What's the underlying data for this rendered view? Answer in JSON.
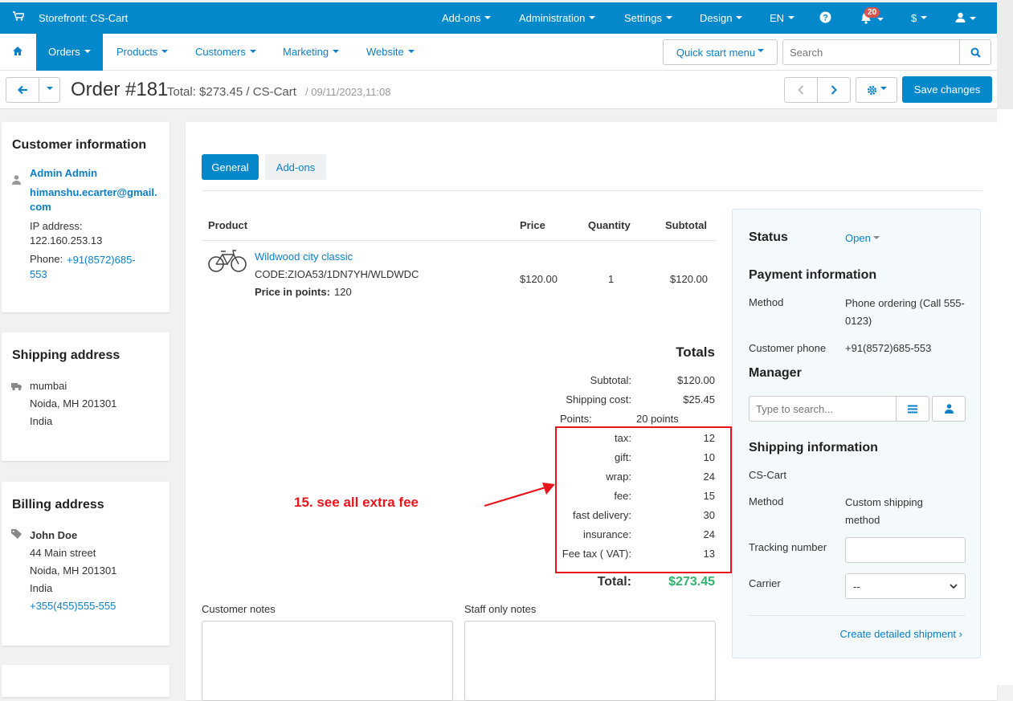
{
  "topbar": {
    "store": "Storefront: CS-Cart",
    "menu": [
      "Add-ons",
      "Administration",
      "Settings",
      "Design",
      "EN"
    ],
    "notif_count": "20",
    "currency": "$"
  },
  "nav": {
    "items": [
      "Orders",
      "Products",
      "Customers",
      "Marketing",
      "Website"
    ],
    "quick_start": "Quick start menu",
    "search_placeholder": "Search"
  },
  "header": {
    "title": "Order #181",
    "total": "Total: $273.45 / CS-Cart",
    "date": "/ 09/11/2023,11:08",
    "save": "Save changes"
  },
  "customer": {
    "heading": "Customer information",
    "name": "Admin Admin",
    "email": "himanshu.ecarter@gmail.com",
    "ip_label": "IP address:",
    "ip": "122.160.253.13",
    "phone_label": "Phone:",
    "phone": "+91(8572)685-553"
  },
  "shipping_address": {
    "heading": "Shipping address",
    "line1": "mumbai",
    "line2": "Noida, MH 201301",
    "line3": "India"
  },
  "billing_address": {
    "heading": "Billing address",
    "name": "John Doe",
    "line1": "44 Main street",
    "line2": "Noida, MH 201301",
    "line3": "India",
    "phone": "+355(455)555-555"
  },
  "tabs": [
    "General",
    "Add-ons"
  ],
  "products": {
    "headers": [
      "Product",
      "Price",
      "Quantity",
      "Subtotal"
    ],
    "item": {
      "name": "Wildwood city classic",
      "code": "CODE:ZIOA53/1DN7YH/WLDWDC",
      "points_label": "Price in points:",
      "points": "120",
      "price": "$120.00",
      "qty": "1",
      "subtotal": "$120.00"
    }
  },
  "totals": {
    "heading": "Totals",
    "rows": [
      {
        "label": "Subtotal:",
        "value": "$120.00"
      },
      {
        "label": "Shipping cost:",
        "value": "$25.45"
      },
      {
        "label": "Points:",
        "value": "20 points"
      }
    ],
    "fees": [
      {
        "label": "tax:",
        "value": "12"
      },
      {
        "label": "gift:",
        "value": "10"
      },
      {
        "label": "wrap:",
        "value": "24"
      },
      {
        "label": "fee:",
        "value": "15"
      },
      {
        "label": "fast delivery:",
        "value": "30"
      },
      {
        "label": "insurance:",
        "value": "24"
      },
      {
        "label": "Fee tax ( VAT):",
        "value": "13"
      }
    ],
    "total_label": "Total:",
    "total_value": "$273.45"
  },
  "annotation": "15. see all extra fee",
  "notes": {
    "customer": "Customer notes",
    "staff": "Staff only notes"
  },
  "sidebar": {
    "status_label": "Status",
    "status_value": "Open",
    "payment_heading": "Payment information",
    "method_label": "Method",
    "method_value": "Phone ordering (Call 555-0123)",
    "phone_label": "Customer phone",
    "phone_value": "+91(8572)685-553",
    "manager_heading": "Manager",
    "manager_placeholder": "Type to search...",
    "shipping_heading": "Shipping information",
    "carrier_name": "CS-Cart",
    "ship_method_label": "Method",
    "ship_method_value": "Custom shipping method",
    "tracking_label": "Tracking number",
    "carrier_label": "Carrier",
    "carrier_value": "--",
    "shipment_link": "Create detailed shipment ›"
  },
  "colors": {
    "brand": "#0388cc",
    "link": "#0b7fc7",
    "total": "#2eb56a",
    "annotation": "#e8151b"
  }
}
